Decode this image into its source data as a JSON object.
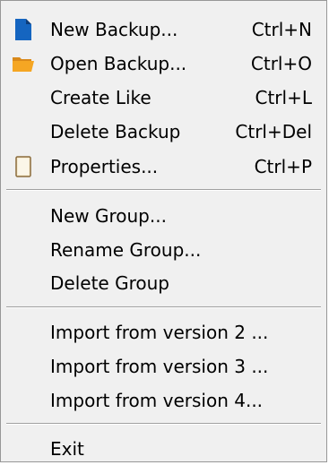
{
  "menu": {
    "items": [
      {
        "label": "New Backup...",
        "shortcut": "Ctrl+N",
        "icon": "new-document-icon"
      },
      {
        "label": "Open Backup...",
        "shortcut": "Ctrl+O",
        "icon": "open-folder-icon"
      },
      {
        "label": "Create Like",
        "shortcut": "Ctrl+L"
      },
      {
        "label": "Delete Backup",
        "shortcut": "Ctrl+Del"
      },
      {
        "label": "Properties...",
        "shortcut": "Ctrl+P",
        "icon": "properties-icon"
      },
      {
        "label": "New Group..."
      },
      {
        "label": "Rename Group..."
      },
      {
        "label": "Delete Group"
      },
      {
        "label": "Import from version 2 ..."
      },
      {
        "label": "Import from version 3 ..."
      },
      {
        "label": "Import from version 4..."
      },
      {
        "label": "Exit"
      }
    ]
  },
  "colors": {
    "menu_background": "#f0f0f0",
    "separator": "#a0a0a0",
    "new_icon_blue": "#1565c0",
    "folder_orange": "#f5a623"
  }
}
